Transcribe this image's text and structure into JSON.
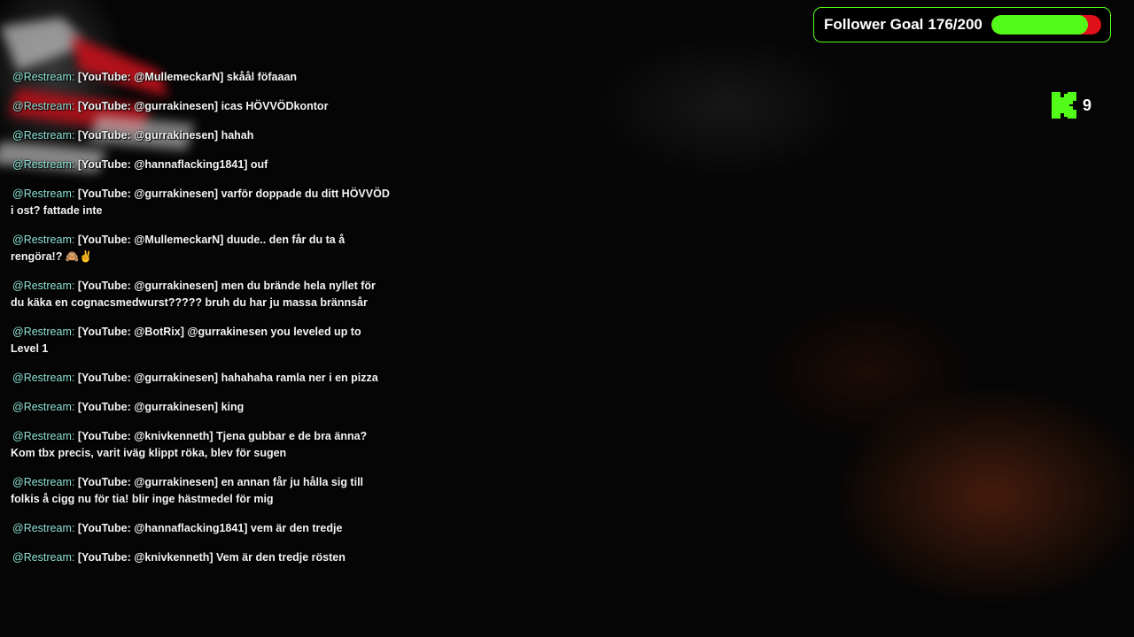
{
  "colors": {
    "accent_green": "#53fc18",
    "goal_remaining_red": "#e0101a",
    "username_teal": "#8fe3d6"
  },
  "follower_goal": {
    "label": "Follower Goal",
    "count_text": "176/200",
    "current": 176,
    "target": 200,
    "progress": 0.88
  },
  "viewers": {
    "icon": "kick-icon",
    "count": "9"
  },
  "chat": {
    "messages": [
      {
        "user": "@Restream:",
        "text": "[YouTube: @MullemeckarN] skåål föfaaan"
      },
      {
        "user": "@Restream:",
        "text": "[YouTube: @gurrakinesen] icas HÖVVÖDkontor"
      },
      {
        "user": "@Restream:",
        "text": "[YouTube: @gurrakinesen] hahah"
      },
      {
        "user": "@Restream:",
        "text": "[YouTube: @hannaflacking1841] ouf"
      },
      {
        "user": "@Restream:",
        "text": "[YouTube: @gurrakinesen] varför doppade du ditt HÖVVÖD i ost? fattade inte"
      },
      {
        "user": "@Restream:",
        "text": "[YouTube: @MullemeckarN] duude.. den får du ta å rengöra!? 🙈✌️"
      },
      {
        "user": "@Restream:",
        "text": "[YouTube: @gurrakinesen] men du brände hela nyllet för du käka en cognacsmedwurst????? bruh du har ju massa brännsår"
      },
      {
        "user": "@Restream:",
        "text": "[YouTube: @BotRix] @gurrakinesen you leveled up to Level 1"
      },
      {
        "user": "@Restream:",
        "text": "[YouTube: @gurrakinesen] hahahaha ramla ner i en pizza"
      },
      {
        "user": "@Restream:",
        "text": "[YouTube: @gurrakinesen] king"
      },
      {
        "user": "@Restream:",
        "text": "[YouTube: @knivkenneth] Tjena gubbar e de bra änna? Kom tbx precis, varit iväg klippt röka, blev för sugen"
      },
      {
        "user": "@Restream:",
        "text": "[YouTube: @gurrakinesen] en annan får ju hålla sig till folkis å cigg nu för tia! blir inge hästmedel för mig"
      },
      {
        "user": "@Restream:",
        "text": "[YouTube: @hannaflacking1841] vem är den tredje"
      },
      {
        "user": "@Restream:",
        "text": "[YouTube: @knivkenneth] Vem är den tredje rösten"
      }
    ]
  }
}
